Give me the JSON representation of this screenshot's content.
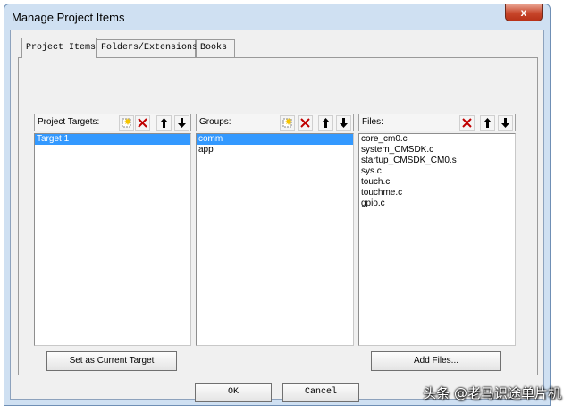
{
  "window": {
    "title": "Manage Project Items",
    "close_label": "x"
  },
  "tabs": [
    {
      "label": "Project Items",
      "active": true
    },
    {
      "label": "Folders/Extensions",
      "active": false
    },
    {
      "label": "Books",
      "active": false
    }
  ],
  "targets": {
    "title": "Project Targets:",
    "items": [
      "Target 1"
    ],
    "selected_index": 0,
    "button_label": "Set as Current Target"
  },
  "groups": {
    "title": "Groups:",
    "items": [
      "comm",
      "app"
    ],
    "selected_index": 0
  },
  "files": {
    "title": "Files:",
    "items": [
      "core_cm0.c",
      "system_CMSDK.c",
      "startup_CMSDK_CM0.s",
      "sys.c",
      "touch.c",
      "touchme.c",
      "gpio.c"
    ],
    "button_label": "Add Files..."
  },
  "footer": {
    "ok_label": "OK",
    "cancel_label": "Cancel"
  },
  "watermark": "头条 @老马识途单片机",
  "colors": {
    "selection": "#3399ff",
    "close_button": "#c7452a",
    "delete_icon": "#c00000"
  }
}
